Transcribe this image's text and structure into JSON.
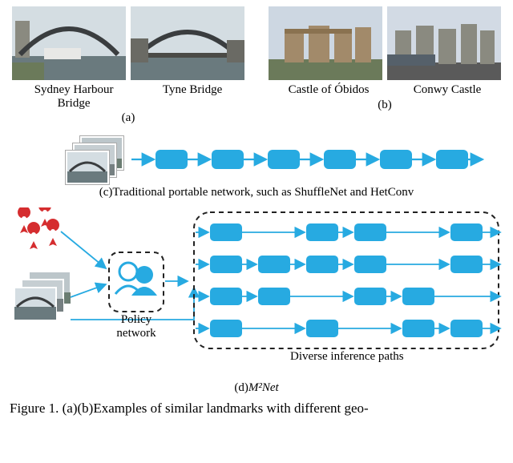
{
  "row_a": {
    "left_label": "Sydney Harbour\nBridge",
    "right_label": "Tyne Bridge",
    "sublabel": "(a)"
  },
  "row_b": {
    "left_label": "Castle of Óbidos",
    "right_label": "Conwy Castle",
    "sublabel": "(b)"
  },
  "caption_c": "(c)Traditional portable network, such as ShuffleNet and HetConv",
  "policy_label": "Policy\nnetwork",
  "paths_label": "Diverse inference paths",
  "caption_d_prefix": "(d)",
  "caption_d_math": "M²Net",
  "figure_caption": "Figure 1. (a)(b)Examples of similar landmarks with different geo-"
}
